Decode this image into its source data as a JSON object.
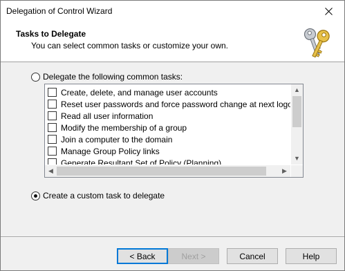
{
  "window": {
    "title": "Delegation of Control Wizard"
  },
  "header": {
    "title": "Tasks to Delegate",
    "subtitle": "You can select common tasks or customize your own.",
    "icon": "keys-icon"
  },
  "options": {
    "common_label": "Delegate the following common tasks:",
    "common_selected": false,
    "custom_label": "Create a custom task to delegate",
    "custom_selected": true
  },
  "tasks": [
    {
      "label": "Create, delete, and manage user accounts",
      "checked": false
    },
    {
      "label": "Reset user passwords and force password change at next logon",
      "checked": false
    },
    {
      "label": "Read all user information",
      "checked": false
    },
    {
      "label": "Modify the membership of a group",
      "checked": false
    },
    {
      "label": "Join a computer to the domain",
      "checked": false
    },
    {
      "label": "Manage Group Policy links",
      "checked": false
    },
    {
      "label": "Generate Resultant Set of Policy (Planning)",
      "checked": false
    }
  ],
  "buttons": {
    "back": "< Back",
    "next": "Next >",
    "cancel": "Cancel",
    "help": "Help"
  },
  "colors": {
    "focus_border": "#0078d7",
    "header_bg": "#ffffff",
    "body_bg": "#f0f0f0"
  }
}
